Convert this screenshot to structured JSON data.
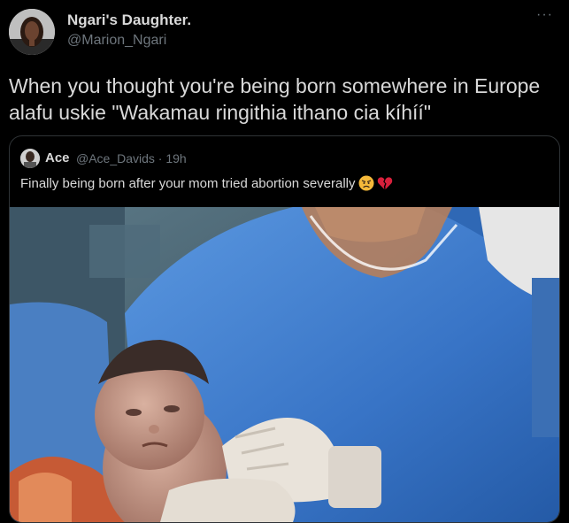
{
  "author": {
    "display_name": "Ngari's Daughter.",
    "handle": "@Marion_Ngari"
  },
  "more_label": "···",
  "tweet_text": "When you thought you're being born somewhere in Europe alafu uskie \"Wakamau ringithia ithano cia kíhíí\"",
  "quoted": {
    "display_name": "Ace",
    "meta": "@Ace_Davids · 19h",
    "text": "Finally being born after your mom tried abortion severally",
    "emojis": [
      "angry-face-emoji",
      "broken-heart-emoji"
    ],
    "image": "newborn baby held by surgeon in blue scrubs"
  },
  "colors": {
    "background": "#000000",
    "text": "#d9d9d9",
    "secondary": "#6e767d",
    "border": "#2f3336",
    "scrubs": "#3f7fd0"
  }
}
